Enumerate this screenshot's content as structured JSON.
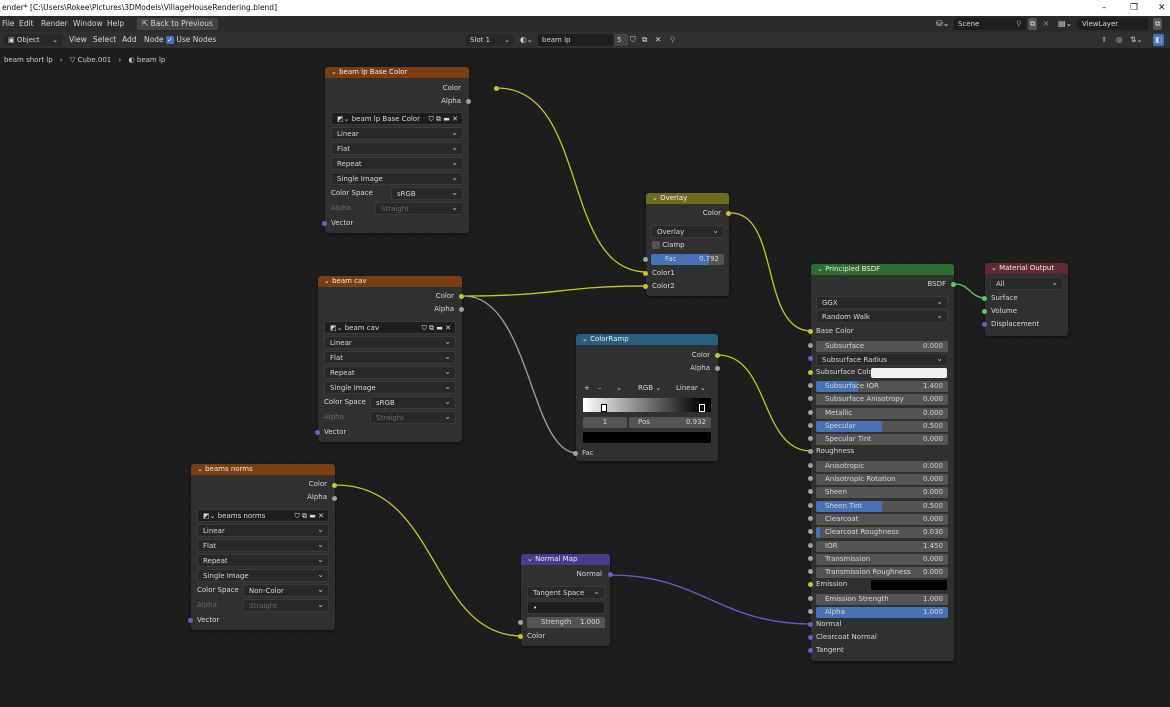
{
  "window": {
    "title": "ender* [C:\\Users\\Rokee\\Pictures\\3DModels\\VillageHouseRendering.blend]",
    "minimize": "–",
    "restore": "❐",
    "close": "✕"
  },
  "menu": {
    "file": "File",
    "edit": "Edit",
    "render": "Render",
    "window": "Window",
    "help": "Help",
    "back": "Back to Previous",
    "scene": "Scene",
    "view_layer": "ViewLayer"
  },
  "header": {
    "mode": "Object",
    "view": "View",
    "select": "Select",
    "add": "Add",
    "node": "Node",
    "use_nodes": "Use Nodes",
    "slot": "Slot 1",
    "material": "beam lp",
    "users": "5"
  },
  "breadcrumb": {
    "object": "beam short lp",
    "mesh": "Cube.001",
    "material": "beam lp"
  },
  "nodes": {
    "base_color": {
      "title": "beam lp Base Color",
      "out_color": "Color",
      "out_alpha": "Alpha",
      "image": "beam lp Base Color",
      "interp": "Linear",
      "proj": "Flat",
      "ext": "Repeat",
      "source": "Single Image",
      "cs_label": "Color Space",
      "cs_value": "sRGB",
      "alpha_label": "Alpha",
      "alpha_value": "Straight",
      "vector": "Vector"
    },
    "cav": {
      "title": "beam cav",
      "out_color": "Color",
      "out_alpha": "Alpha",
      "image": "beam cav",
      "interp": "Linear",
      "proj": "Flat",
      "ext": "Repeat",
      "source": "Single Image",
      "cs_label": "Color Space",
      "cs_value": "sRGB",
      "alpha_label": "Alpha",
      "alpha_value": "Straight",
      "vector": "Vector"
    },
    "norms": {
      "title": "beams norms",
      "out_color": "Color",
      "out_alpha": "Alpha",
      "image": "beams norms",
      "interp": "Linear",
      "proj": "Flat",
      "ext": "Repeat",
      "source": "Single Image",
      "cs_label": "Color Space",
      "cs_value": "Non-Color",
      "alpha_label": "Alpha",
      "alpha_value": "Straight",
      "vector": "Vector"
    },
    "overlay": {
      "title": "Overlay",
      "out_color": "Color",
      "blend": "Overlay",
      "clamp": "Clamp",
      "fac_label": "Fac",
      "fac_value": "0.792",
      "fac_fraction": 0.792,
      "in1": "Color1",
      "in2": "Color2"
    },
    "ramp": {
      "title": "ColorRamp",
      "out_color": "Color",
      "out_alpha": "Alpha",
      "plus": "+",
      "minus": "–",
      "mode": "RGB",
      "interp": "Linear",
      "index": "1",
      "pos_label": "Pos",
      "pos_value": "0.932",
      "fac": "Fac"
    },
    "normal_map": {
      "title": "Normal Map",
      "out": "Normal",
      "space": "Tangent Space",
      "uv": "•",
      "strength_label": "Strength",
      "strength_value": "1.000",
      "in_color": "Color"
    },
    "bsdf": {
      "title": "Principled BSDF",
      "out": "BSDF",
      "dist": "GGX",
      "sss_method": "Random Walk",
      "base_color": "Base Color",
      "fields": [
        {
          "label": "Subsurface",
          "value": "0.000",
          "fill": 0
        },
        {
          "label": "Subsurface Radius",
          "value": "",
          "fill": 0,
          "dropdown": true
        },
        {
          "label": "Subsurface Colo",
          "value": "",
          "fill": 0,
          "swatch": "#f0f0f0"
        },
        {
          "label": "Subsurface IOR",
          "value": "1.400",
          "fill": 0.32
        },
        {
          "label": "Subsurface Anisotropy",
          "value": "0.000",
          "fill": 0
        },
        {
          "label": "Metallic",
          "value": "0.000",
          "fill": 0
        },
        {
          "label": "Specular",
          "value": "0.500",
          "fill": 0.5
        },
        {
          "label": "Specular Tint",
          "value": "0.000",
          "fill": 0
        },
        {
          "label": "Roughness",
          "value": "",
          "fill": 0,
          "socket_only": true
        },
        {
          "label": "Anisotropic",
          "value": "0.000",
          "fill": 0
        },
        {
          "label": "Anisotropic Rotation",
          "value": "0.000",
          "fill": 0
        },
        {
          "label": "Sheen",
          "value": "0.000",
          "fill": 0
        },
        {
          "label": "Sheen Tint",
          "value": "0.500",
          "fill": 0.5
        },
        {
          "label": "Clearcoat",
          "value": "0.000",
          "fill": 0
        },
        {
          "label": "Clearcoat Roughness",
          "value": "0.030",
          "fill": 0.03
        },
        {
          "label": "IOR",
          "value": "1.450",
          "fill": 0
        },
        {
          "label": "Transmission",
          "value": "0.000",
          "fill": 0
        },
        {
          "label": "Transmission Roughness",
          "value": "0.000",
          "fill": 0
        },
        {
          "label": "Emission",
          "value": "",
          "fill": 0,
          "swatch": "#000000"
        },
        {
          "label": "Emission Strength",
          "value": "1.000",
          "fill": 0
        },
        {
          "label": "Alpha",
          "value": "1.000",
          "fill": 1
        }
      ],
      "normal": "Normal",
      "clearcoat_normal": "Clearcoat Normal",
      "tangent": "Tangent"
    },
    "output": {
      "title": "Material Output",
      "target": "All",
      "surface": "Surface",
      "volume": "Volume",
      "displacement": "Displacement"
    }
  },
  "colors": {
    "image_header": "#7a3e12",
    "color_header": "#6f6c1b",
    "converter_header": "#285e82",
    "vector_header": "#4a3c8c",
    "shader_header": "#2e6b2e",
    "output_header": "#5f2a36",
    "color_socket": "#c7c729",
    "vector_socket": "#6363c7",
    "shader_socket": "#63c763",
    "value_socket": "#a1a1a1",
    "accent": "#4772b3"
  }
}
